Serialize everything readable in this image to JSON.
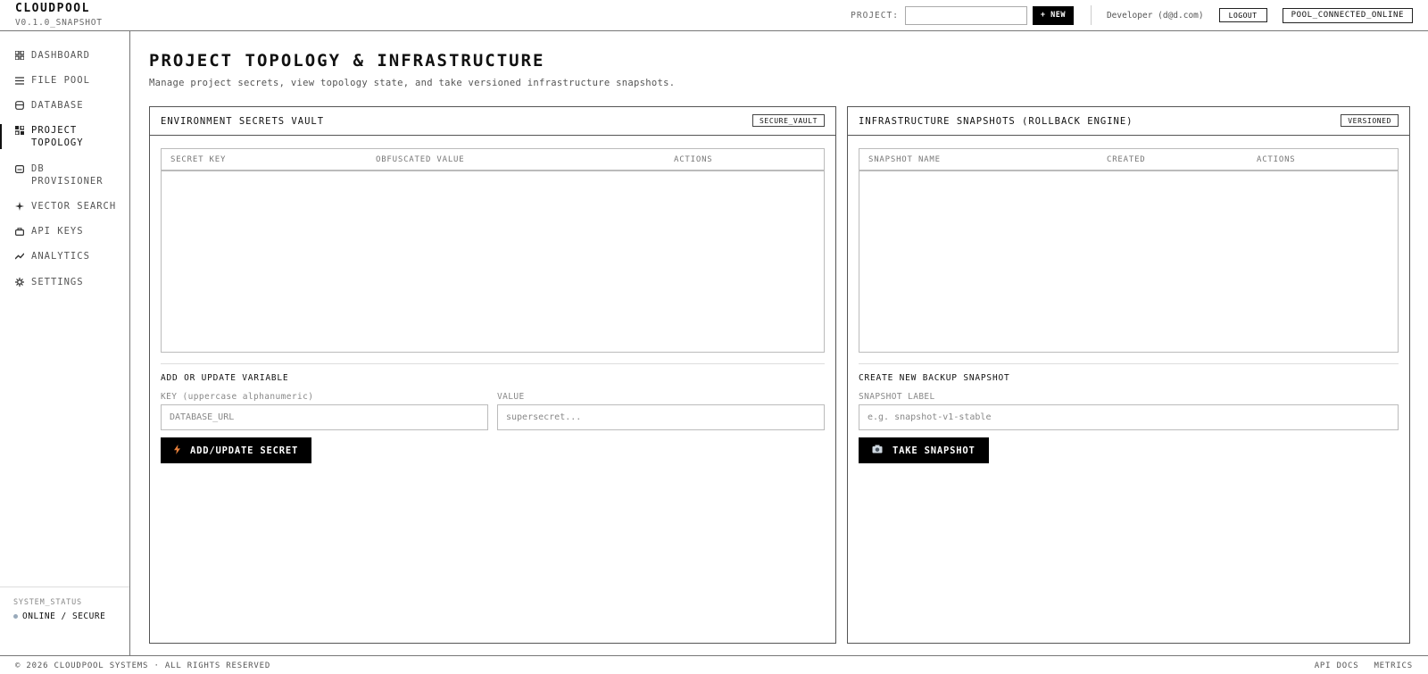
{
  "header": {
    "brand": "CLOUDPOOL",
    "version": "V0.1.0_SNAPSHOT",
    "project_label": "PROJECT:",
    "project_value": "",
    "new_button": "+ NEW",
    "user": "Developer (d@d.com)",
    "logout": "LOGOUT",
    "pool_status": "POOL_CONNECTED_ONLINE"
  },
  "sidebar": {
    "items": [
      {
        "label": "DASHBOARD",
        "icon": "grid-icon"
      },
      {
        "label": "FILE POOL",
        "icon": "list-icon"
      },
      {
        "label": "DATABASE",
        "icon": "database-icon"
      },
      {
        "label": "PROJECT\nTOPOLOGY",
        "icon": "topology-icon",
        "active": true
      },
      {
        "label": "DB\nPROVISIONER",
        "icon": "server-icon"
      },
      {
        "label": "VECTOR SEARCH",
        "icon": "sparkle-icon"
      },
      {
        "label": "API KEYS",
        "icon": "key-icon"
      },
      {
        "label": "ANALYTICS",
        "icon": "chart-icon"
      },
      {
        "label": "SETTINGS",
        "icon": "gear-icon"
      }
    ],
    "system_status_label": "SYSTEM_STATUS",
    "system_status_value": "ONLINE / SECURE"
  },
  "main": {
    "title": "PROJECT TOPOLOGY & INFRASTRUCTURE",
    "subtitle": "Manage project secrets, view topology state, and take versioned infrastructure snapshots."
  },
  "secrets": {
    "title": "ENVIRONMENT SECRETS VAULT",
    "badge": "SECURE_VAULT",
    "columns": [
      "SECRET KEY",
      "OBFUSCATED VALUE",
      "ACTIONS"
    ],
    "rows": [],
    "form_title": "ADD OR UPDATE VARIABLE",
    "key_label": "KEY (uppercase alphanumeric)",
    "key_placeholder": "DATABASE_URL",
    "value_label": "VALUE",
    "value_placeholder": "supersecret...",
    "button": "ADD/UPDATE SECRET"
  },
  "snapshots": {
    "title": "INFRASTRUCTURE SNAPSHOTS (ROLLBACK ENGINE)",
    "badge": "VERSIONED",
    "columns": [
      "SNAPSHOT NAME",
      "CREATED",
      "ACTIONS"
    ],
    "rows": [],
    "form_title": "CREATE NEW BACKUP SNAPSHOT",
    "label_label": "SNAPSHOT LABEL",
    "label_placeholder": "e.g. snapshot-v1-stable",
    "button": "TAKE SNAPSHOT"
  },
  "footer": {
    "copyright": "© 2026 CLOUDPOOL SYSTEMS · ALL RIGHTS RESERVED",
    "links": [
      "API DOCS",
      "METRICS"
    ]
  },
  "colors": {
    "status_dot": "#99aabb",
    "bolt_icon": "#e8803a"
  }
}
